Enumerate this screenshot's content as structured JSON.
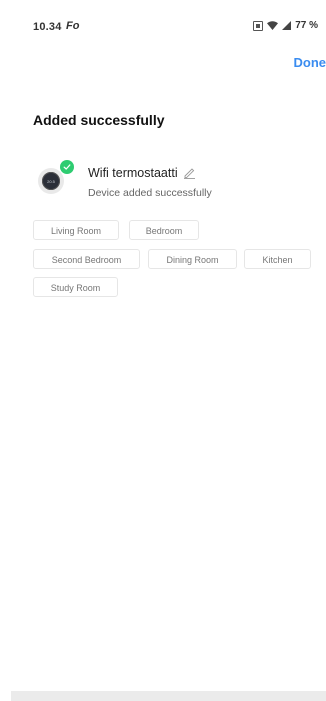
{
  "status_bar": {
    "time": "10.34",
    "notification_glyph": "Fo",
    "battery": "77 %",
    "icons": [
      "sim-icon",
      "wifi-icon",
      "signal-icon"
    ]
  },
  "header": {
    "done_label": "Done"
  },
  "page": {
    "title": "Added successfully"
  },
  "device": {
    "name": "Wifi termostaatti",
    "status": "Device added successfully",
    "thumbnail_text": "20.5",
    "icons": [
      "thermostat-icon",
      "check-icon",
      "edit-icon"
    ]
  },
  "rooms": [
    "Living Room",
    "Bedroom",
    "Second Bedroom",
    "Dining Room",
    "Kitchen",
    "Study Room"
  ],
  "colors": {
    "accent": "#3a8cf0",
    "success": "#2ecc71"
  }
}
